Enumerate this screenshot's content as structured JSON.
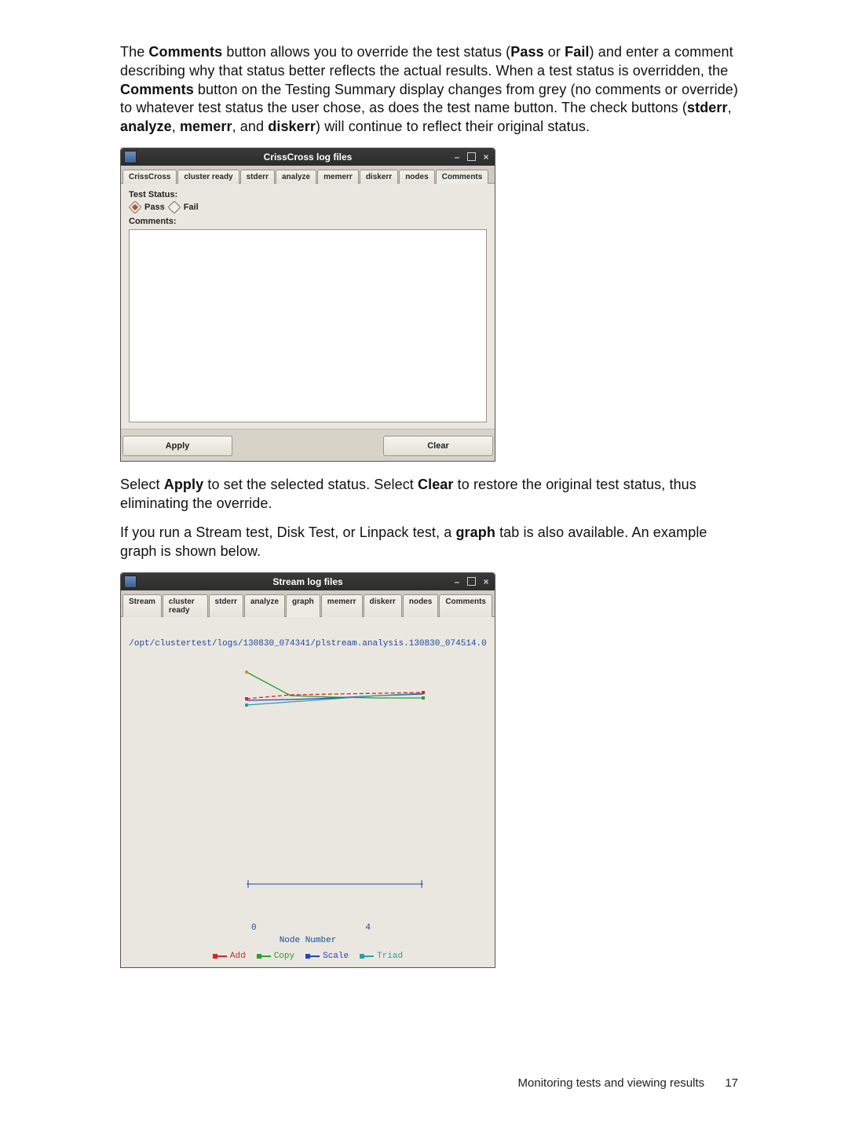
{
  "paras": {
    "p1a": "The ",
    "p1b": "Comments",
    "p1c": " button allows you to override the test status (",
    "p1d": "Pass",
    "p1e": " or ",
    "p1f": "Fail",
    "p1g": ") and enter a comment describing why that status better reflects the actual results. When a test status is overridden, the ",
    "p1h": "Comments",
    "p1i": " button on the Testing Summary display changes from grey (no comments or override) to whatever test status the user chose, as does the test name button. The check buttons (",
    "p1j": "stderr",
    "p1k": ", ",
    "p1l": "analyze",
    "p1m": ", ",
    "p1n": "memerr",
    "p1o": ", and ",
    "p1p": "diskerr",
    "p1q": ") will continue to reflect their original status."
  },
  "paras2": {
    "p2a": "Select ",
    "p2b": "Apply",
    "p2c": " to set the selected status. Select ",
    "p2d": "Clear",
    "p2e": " to restore the original test status, thus eliminating the override.",
    "p3a": "If you run a Stream test, Disk Test, or Linpack test, a ",
    "p3b": "graph",
    "p3c": " tab is also available. An example graph is shown below."
  },
  "win1": {
    "title": "CrissCross log files",
    "tabs": [
      "CrissCross",
      "cluster ready",
      "stderr",
      "analyze",
      "memerr",
      "diskerr",
      "nodes",
      "Comments"
    ],
    "test_status_label": "Test Status:",
    "pass": "Pass",
    "fail": "Fail",
    "comments_label": "Comments:",
    "apply": "Apply",
    "clear": "Clear"
  },
  "win2": {
    "title": "Stream log files",
    "tabs": [
      "Stream",
      "cluster ready",
      "stderr",
      "analyze",
      "graph",
      "memerr",
      "diskerr",
      "nodes",
      "Comments"
    ],
    "path": "/opt/clustertest/logs/130830_074341/plstream.analysis.130830_074514.0",
    "xmin": "0",
    "xmax": "4",
    "xlabel": "Node Number",
    "legend": [
      "Add",
      "Copy",
      "Scale",
      "Triad"
    ]
  },
  "chart_data": {
    "type": "line",
    "title": "/opt/clustertest/logs/130830_074341/plstream.analysis.130830_074514.0",
    "xlabel": "Node Number",
    "ylabel": "",
    "x": [
      0,
      1,
      2,
      3,
      4
    ],
    "series": [
      {
        "name": "Add",
        "color": "#cc2a2a",
        "values": [
          17,
          22,
          23,
          24,
          25
        ]
      },
      {
        "name": "Copy",
        "color": "#2aa02a",
        "values": [
          50,
          28,
          27,
          26,
          26
        ]
      },
      {
        "name": "Scale",
        "color": "#2a3fcc",
        "values": [
          18,
          20,
          22,
          23,
          24
        ]
      },
      {
        "name": "Triad",
        "color": "#2aa0a0",
        "values": [
          14,
          19,
          22,
          24,
          25
        ]
      }
    ],
    "xlim": [
      0,
      4
    ],
    "ylim": [
      0,
      60
    ]
  },
  "footer": {
    "text": "Monitoring tests and viewing results",
    "page": "17"
  }
}
